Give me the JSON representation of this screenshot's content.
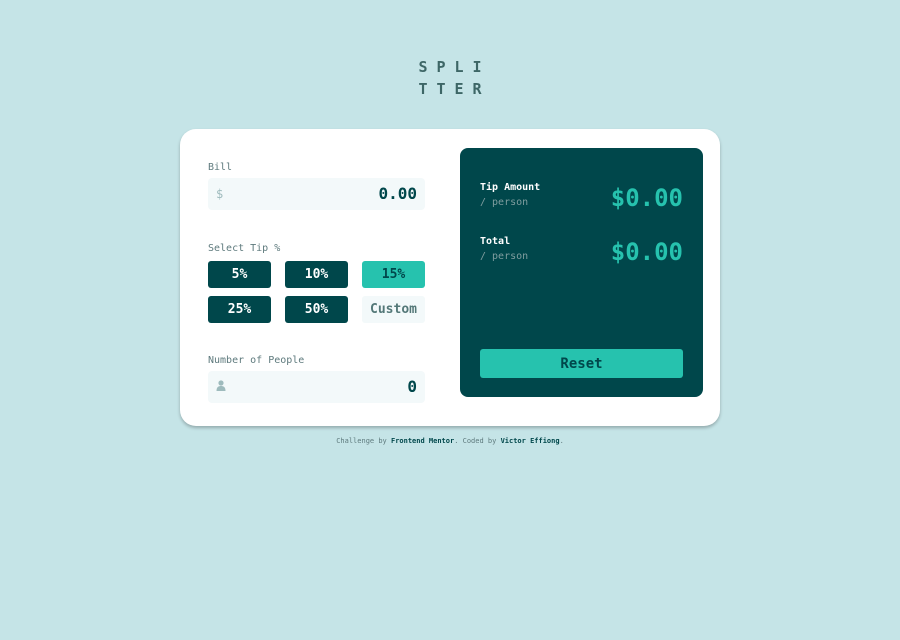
{
  "logo": {
    "line1": "SPLI",
    "line2": "TTER"
  },
  "bill": {
    "label": "Bill",
    "currency_symbol": "$",
    "value": "0.00"
  },
  "tip": {
    "label": "Select Tip %",
    "options": [
      "5%",
      "10%",
      "15%",
      "25%",
      "50%"
    ],
    "selected": "15%",
    "custom_placeholder": "Custom"
  },
  "people": {
    "label": "Number of People",
    "value": "0",
    "icon": "person-icon"
  },
  "results": {
    "tip_title": "Tip Amount",
    "tip_sub": "/ person",
    "tip_value": "$0.00",
    "total_title": "Total",
    "total_sub": "/ person",
    "total_value": "$0.00",
    "reset_label": "Reset"
  },
  "footer": {
    "prefix": "Challenge by",
    "link1": "Frontend Mentor",
    "middle": ". Coded by",
    "link2": "Victor Effiong",
    "suffix": "."
  },
  "colors": {
    "background": "#c5e4e7",
    "dark_cyan": "#00474b",
    "strong_cyan": "#26c2ae",
    "input_bg": "#f3f9fa"
  }
}
